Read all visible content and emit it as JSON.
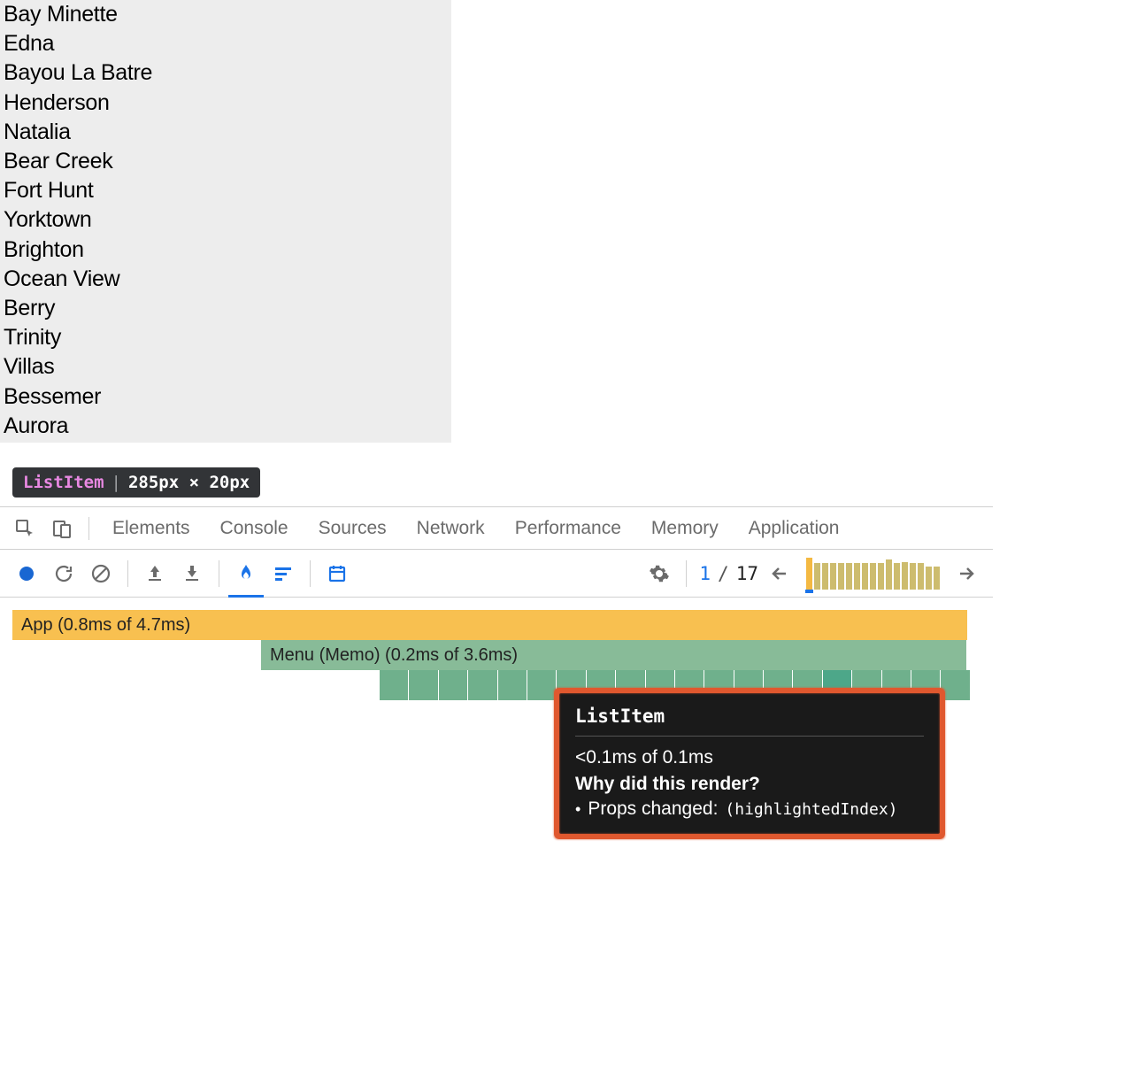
{
  "list_items": [
    "Bay Minette",
    "Edna",
    "Bayou La Batre",
    "Henderson",
    "Natalia",
    "Bear Creek",
    "Fort Hunt",
    "Yorktown",
    "Brighton",
    "Ocean View",
    "Berry",
    "Trinity",
    "Villas",
    "Bessemer",
    "Aurora"
  ],
  "inspector": {
    "component": "ListItem",
    "dimensions": "285px × 20px"
  },
  "devtools": {
    "tabs": [
      "Elements",
      "Console",
      "Sources",
      "Network",
      "Performance",
      "Memory",
      "Application"
    ]
  },
  "profiler": {
    "commit_current": "1",
    "commit_separator": "/",
    "commit_total": "17",
    "commit_bars": [
      36,
      30,
      30,
      30,
      30,
      30,
      30,
      30,
      30,
      30,
      34,
      30,
      31,
      30,
      30,
      26,
      26
    ]
  },
  "flamegraph": {
    "app_label": "App (0.8ms of 4.7ms)",
    "menu_label": "Menu (Memo) (0.2ms of 3.6ms)",
    "item_count": 20,
    "highlighted_item_index": 15
  },
  "tooltip": {
    "title": "ListItem",
    "timing": "<0.1ms of 0.1ms",
    "why_heading": "Why did this render?",
    "reason_prefix": "Props changed:",
    "reason_detail": "(highlightedIndex)"
  }
}
